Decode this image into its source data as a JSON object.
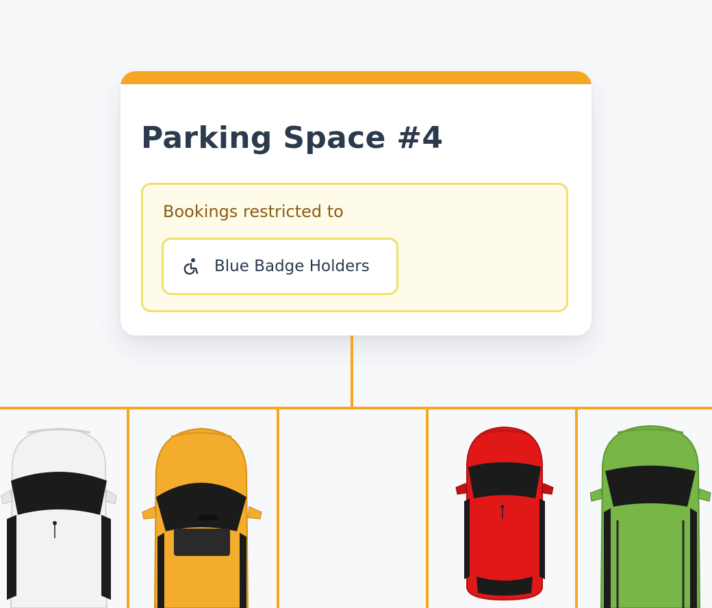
{
  "card": {
    "title": "Parking Space #4",
    "accent_color": "#f6a622",
    "restriction": {
      "label": "Bookings restricted to",
      "badge": {
        "icon": "wheelchair-icon",
        "label": "Blue Badge Holders"
      }
    }
  },
  "parking_lot": {
    "line_color": "#f6a622",
    "bays": [
      {
        "car_color": "#f2f2f2",
        "occupied": true
      },
      {
        "car_color": "#f4ac2c",
        "occupied": true
      },
      {
        "occupied": false
      },
      {
        "car_color": "#e01818",
        "occupied": true
      },
      {
        "car_color": "#78b648",
        "occupied": true
      }
    ]
  }
}
